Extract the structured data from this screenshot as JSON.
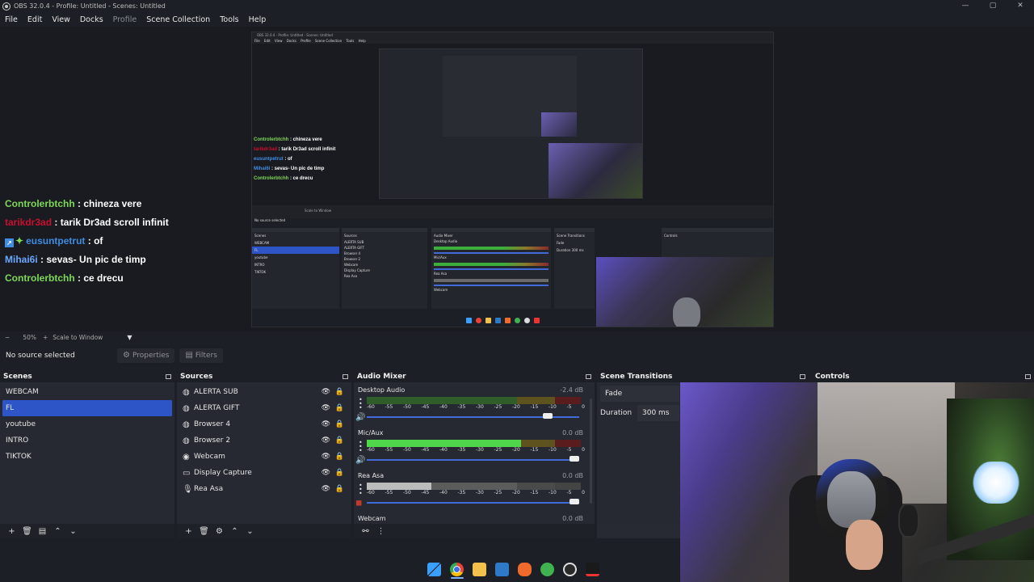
{
  "window": {
    "title": "OBS 32.0.4 - Profile: Untitled - Scenes: Untitled",
    "controls": [
      "—",
      "▢",
      "✕"
    ]
  },
  "menu": [
    "File",
    "Edit",
    "View",
    "Docks",
    "Profile",
    "Scene Collection",
    "Tools",
    "Help"
  ],
  "chat": [
    {
      "user": "Controlerbtchh",
      "msg": " : chineza vere",
      "color": "#7ed957"
    },
    {
      "user": "tarikdr3ad",
      "msg": " : tarik Dr3ad scroll infinit",
      "color": "#c8102e"
    },
    {
      "user": "eusuntpetrut",
      "msg": " : of",
      "color": "#3f8de0"
    },
    {
      "user": "Mihai6i",
      "msg": " : sevas- Un pic de timp",
      "color": "#6aa8ff"
    },
    {
      "user": "Controlerbtchh",
      "msg": " : ce drecu",
      "color": "#7ed957"
    }
  ],
  "zoom": {
    "minus": "−",
    "value": "50%",
    "plus": "+",
    "mode": "Scale to Window",
    "caret": "▼"
  },
  "source_toolbar": {
    "no_source": "No source selected",
    "properties": "Properties",
    "filters": "Filters"
  },
  "scenes": {
    "title": "Scenes",
    "items": [
      "WEBCAM",
      "FL",
      "youtube",
      "INTRO",
      "TIKTOK"
    ],
    "selected": 1
  },
  "sources": {
    "title": "Sources",
    "items": [
      {
        "name": "ALERTA SUB",
        "icon": "browser-icon"
      },
      {
        "name": "ALERTA GIFT",
        "icon": "browser-icon"
      },
      {
        "name": "Browser 4",
        "icon": "browser-icon"
      },
      {
        "name": "Browser 2",
        "icon": "browser-icon"
      },
      {
        "name": "Webcam",
        "icon": "camera-icon"
      },
      {
        "name": "Display Capture",
        "icon": "monitor-icon"
      },
      {
        "name": "Rea Asa",
        "icon": "microphone-icon"
      }
    ]
  },
  "mixer": {
    "title": "Audio Mixer",
    "ticks": [
      "-60",
      "-55",
      "-50",
      "-45",
      "-40",
      "-35",
      "-30",
      "-25",
      "-20",
      "-15",
      "-10",
      "-5",
      "0"
    ],
    "channels": [
      {
        "name": "Desktop Audio",
        "db": "-2.4 dB",
        "level": 0.0,
        "volume": 0.87
      },
      {
        "name": "Mic/Aux",
        "db": "0.0 dB",
        "level": 0.72,
        "volume": 1.0
      },
      {
        "name": "Rea Asa",
        "db": "0.0 dB",
        "level": 0.3,
        "volume": 1.0
      },
      {
        "name": "Webcam",
        "db": "0.0 dB",
        "level": 0.0,
        "volume": 1.0
      }
    ]
  },
  "transitions": {
    "title": "Scene Transitions",
    "type": "Fade",
    "duration_label": "Duration",
    "duration": "300 ms"
  },
  "controls": {
    "title": "Controls"
  },
  "nested": {
    "title": "OBS 32.0.4 - Profile: Untitled - Scenes: Untitled",
    "menu": [
      "File",
      "Edit",
      "View",
      "Docks",
      "Profile",
      "Scene Collection",
      "Tools",
      "Help"
    ],
    "chat": [
      {
        "user": "Controlerbtchh",
        "msg": " : chineza vere"
      },
      {
        "user": "tarikdr3ad",
        "msg": " : tarik Dr3ad scroll infinit"
      },
      {
        "user": "eusuntpetrut",
        "msg": " : of"
      },
      {
        "user": "Mihai6i",
        "msg": " : sevas- Un pic de timp"
      },
      {
        "user": "Controlerbtchh",
        "msg": " : ce drecu"
      }
    ],
    "no_source": "No source selected",
    "scale": "Scale to Window",
    "panels": [
      "Scenes",
      "Sources",
      "Audio Mixer",
      "Scene Transitions",
      "Controls"
    ],
    "scenes": [
      "WEBCAM",
      "FL",
      "youtube",
      "INTRO",
      "TIKTOK"
    ],
    "sources": [
      "ALERTA SUB",
      "ALERTA GIFT",
      "Browser 4",
      "Browser 2",
      "Webcam",
      "Display Capture",
      "Rea Asa"
    ],
    "mixer": [
      "Desktop Audio",
      "Mic/Aux",
      "Rea Asa",
      "Webcam"
    ],
    "transition": "Fade",
    "duration_label": "Duration",
    "duration": "300 ms"
  }
}
